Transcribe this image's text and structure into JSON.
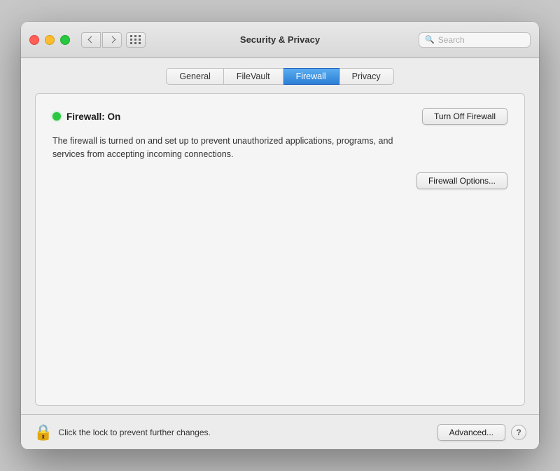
{
  "window": {
    "title": "Security & Privacy"
  },
  "titlebar": {
    "back_label": "‹",
    "forward_label": "›",
    "search_placeholder": "Search"
  },
  "tabs": [
    {
      "id": "general",
      "label": "General",
      "active": false
    },
    {
      "id": "filevault",
      "label": "FileVault",
      "active": false
    },
    {
      "id": "firewall",
      "label": "Firewall",
      "active": true
    },
    {
      "id": "privacy",
      "label": "Privacy",
      "active": false
    }
  ],
  "firewall": {
    "status_dot_color": "#28c840",
    "status_label": "Firewall: On",
    "toggle_button": "Turn Off Firewall",
    "description": "The firewall is turned on and set up to prevent unauthorized applications, programs, and services from accepting incoming connections.",
    "options_button": "Firewall Options..."
  },
  "bottom": {
    "lock_text": "Click the lock to prevent further changes.",
    "advanced_button": "Advanced...",
    "help_label": "?"
  }
}
